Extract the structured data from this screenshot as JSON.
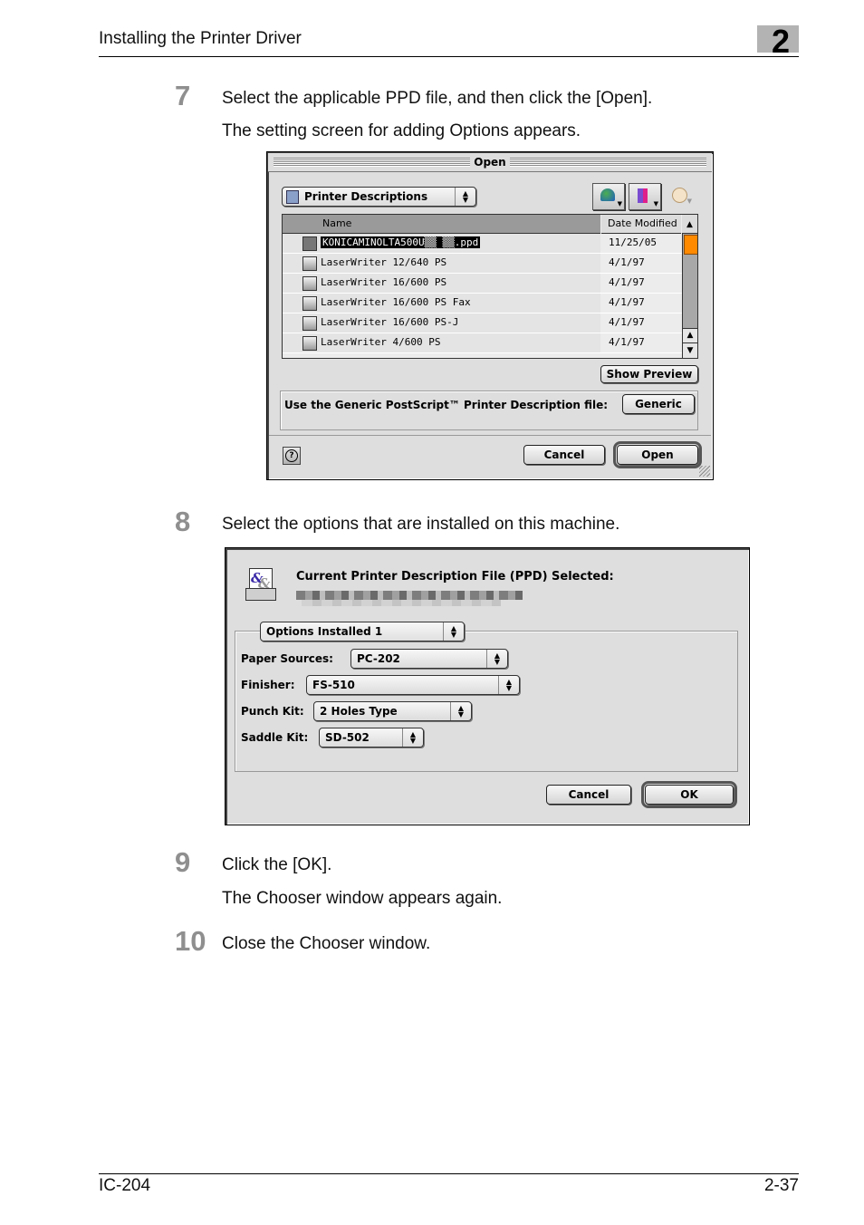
{
  "header": {
    "title": "Installing the Printer Driver",
    "chapter": "2"
  },
  "footer": {
    "model": "IC-204",
    "page": "2-37"
  },
  "steps": [
    {
      "number": "7",
      "text": "Select the applicable PPD file, and then click the [Open].",
      "subtext": "The setting screen for adding Options appears."
    },
    {
      "number": "8",
      "text": "Select the options that are installed on this machine."
    },
    {
      "number": "9",
      "text": "Click the [OK].",
      "subtext": "The Chooser window appears again."
    },
    {
      "number": "10",
      "text": "Close the Chooser window."
    }
  ],
  "open_dialog": {
    "title": "Open",
    "location_popup": "Printer Descriptions",
    "columns": {
      "name": "Name",
      "date": "Date Modified"
    },
    "files": [
      {
        "name": "KONICAMINOLTA500U▒▒ ▒▒.ppd",
        "date": "11/25/05",
        "icon": "document-icon",
        "selected": true
      },
      {
        "name": "LaserWriter 12/640 PS",
        "date": "4/1/97",
        "icon": "printer-icon"
      },
      {
        "name": "LaserWriter 16/600 PS",
        "date": "4/1/97",
        "icon": "printer-icon"
      },
      {
        "name": "LaserWriter 16/600 PS Fax",
        "date": "4/1/97",
        "icon": "printer-icon"
      },
      {
        "name": "LaserWriter 16/600 PS-J",
        "date": "4/1/97",
        "icon": "printer-icon"
      },
      {
        "name": "LaserWriter 4/600 PS",
        "date": "4/1/97",
        "icon": "printer-icon"
      }
    ],
    "show_preview": "Show Preview",
    "generic_label": "Use the Generic PostScript™ Printer Description file:",
    "generic_button": "Generic",
    "cancel": "Cancel",
    "open": "Open",
    "accent_color": "#ff8a00"
  },
  "options_dialog": {
    "heading": "Current Printer Description File (PPD) Selected:",
    "group_popup": "Options Installed 1",
    "fields": [
      {
        "label": "Paper Sources:",
        "value": "PC-202"
      },
      {
        "label": "Finisher:",
        "value": "FS-510"
      },
      {
        "label": "Punch Kit:",
        "value": "2 Holes Type"
      },
      {
        "label": "Saddle Kit:",
        "value": "SD-502"
      }
    ],
    "cancel": "Cancel",
    "ok": "OK"
  }
}
